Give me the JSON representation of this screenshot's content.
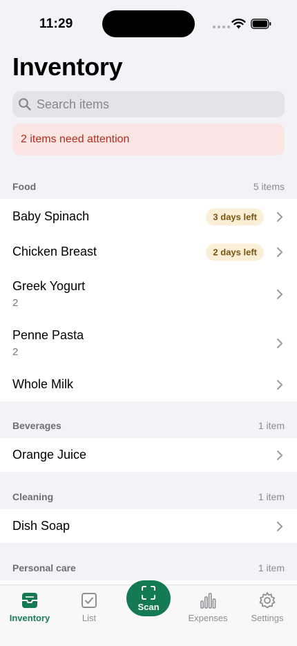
{
  "status_bar": {
    "time": "11:29"
  },
  "header": {
    "title": "Inventory"
  },
  "search": {
    "placeholder": "Search items",
    "value": ""
  },
  "alert": {
    "text": "2 items need attention",
    "color": "#b32a20"
  },
  "sections": [
    {
      "title": "Food",
      "count": "5 items",
      "items": [
        {
          "name": "Baby Spinach",
          "badge": "3 days left"
        },
        {
          "name": "Chicken Breast",
          "badge": "2 days left"
        },
        {
          "name": "Greek Yogurt",
          "quantity": "2"
        },
        {
          "name": "Penne Pasta",
          "quantity": "2"
        },
        {
          "name": "Whole Milk"
        }
      ]
    },
    {
      "title": "Beverages",
      "count": "1 item",
      "items": [
        {
          "name": "Orange Juice"
        }
      ]
    },
    {
      "title": "Cleaning",
      "count": "1 item",
      "items": [
        {
          "name": "Dish Soap"
        }
      ]
    },
    {
      "title": "Personal care",
      "count": "1 item",
      "items": []
    }
  ],
  "tab_bar": {
    "accent_color": "#147a53",
    "tabs": [
      {
        "label": "Inventory",
        "icon": "tray-icon",
        "active": true
      },
      {
        "label": "List",
        "icon": "checklist-icon"
      },
      {
        "label": "Scan",
        "icon": "scan-icon"
      },
      {
        "label": "Expenses",
        "icon": "bar-chart-icon"
      },
      {
        "label": "Settings",
        "icon": "gear-icon"
      }
    ]
  }
}
